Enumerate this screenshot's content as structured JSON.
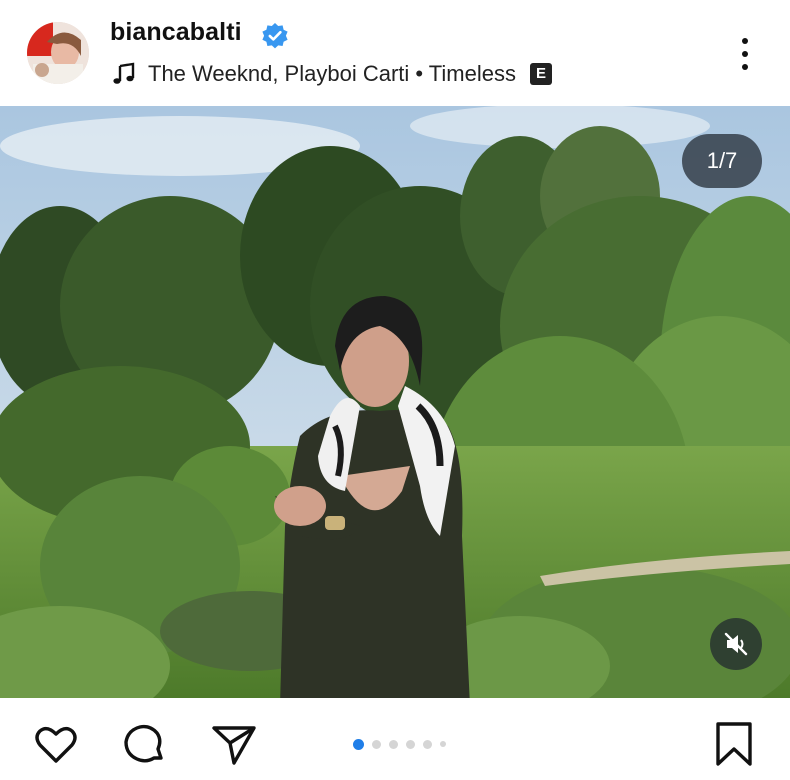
{
  "post": {
    "username": "biancabalti",
    "verified": true,
    "music": {
      "song": "The Weeknd, Playboi Carti • Timeless",
      "explicit_badge": "E"
    }
  },
  "media": {
    "counter": "1/7",
    "muted": true
  },
  "carousel": {
    "total_dots": 6,
    "active_index": 0
  },
  "icons": {
    "verified": "verified-badge-icon",
    "music": "music-note-icon",
    "more": "more-options-icon",
    "mute": "muted-speaker-icon",
    "like": "heart-icon",
    "comment": "comment-icon",
    "share": "send-icon",
    "save": "bookmark-icon"
  },
  "colors": {
    "verified": "#3897f0",
    "dot_active": "#1f7ee8",
    "dot_inactive": "#d5d5d5"
  }
}
